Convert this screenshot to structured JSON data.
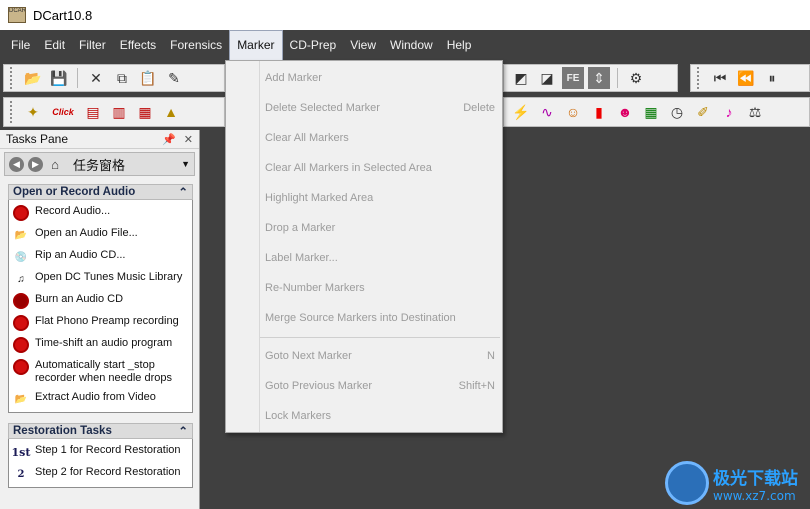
{
  "window": {
    "title": "DCart10.8",
    "icon": "dcart-app-icon"
  },
  "menubar": {
    "items": [
      "File",
      "Edit",
      "Filter",
      "Effects",
      "Forensics",
      "Marker",
      "CD-Prep",
      "View",
      "Window",
      "Help"
    ],
    "active": "Marker"
  },
  "marker_menu": {
    "items": [
      {
        "label": "Add Marker",
        "shortcut": "",
        "enabled": false
      },
      {
        "label": "Delete Selected Marker",
        "shortcut": "Delete",
        "enabled": false
      },
      {
        "label": "Clear All Markers",
        "shortcut": "",
        "enabled": false
      },
      {
        "label": "Clear All Markers in Selected Area",
        "shortcut": "",
        "enabled": false
      },
      {
        "label": "Highlight Marked Area",
        "shortcut": "",
        "enabled": false
      },
      {
        "label": "Drop a Marker",
        "shortcut": "",
        "enabled": false
      },
      {
        "label": "Label Marker...",
        "shortcut": "",
        "enabled": false
      },
      {
        "label": "Re-Number Markers",
        "shortcut": "",
        "enabled": false
      },
      {
        "label": "Merge Source Markers into Destination",
        "shortcut": "",
        "enabled": false
      },
      {
        "label": "Goto Next Marker",
        "shortcut": "N",
        "enabled": false
      },
      {
        "label": "Goto Previous Marker",
        "shortcut": "Shift+N",
        "enabled": false
      },
      {
        "label": "Lock Markers",
        "shortcut": "",
        "enabled": false
      }
    ]
  },
  "tasks_pane": {
    "title": "Tasks Pane",
    "nav_title": "任务窗格",
    "sections": [
      {
        "title": "Open or Record Audio",
        "items": [
          {
            "label": "Record Audio...",
            "icon": "record-icon"
          },
          {
            "label": "Open an Audio File...",
            "icon": "folder-open-icon"
          },
          {
            "label": "Rip an Audio CD...",
            "icon": "rip-cd-icon"
          },
          {
            "label": "Open DC Tunes Music Library",
            "icon": "music-library-icon"
          },
          {
            "label": "Burn an Audio CD",
            "icon": "burn-cd-icon"
          },
          {
            "label": "Flat Phono Preamp recording",
            "icon": "record-icon"
          },
          {
            "label": "Time-shift an audio program",
            "icon": "record-icon"
          },
          {
            "label": "Automatically start _stop recorder when needle drops",
            "icon": "record-icon"
          },
          {
            "label": "Extract Audio from Video",
            "icon": "folder-open-icon"
          }
        ]
      },
      {
        "title": "Restoration Tasks",
        "items": [
          {
            "label": "Step 1 for Record Restoration",
            "icon": "step-1st-icon",
            "num": "1st"
          },
          {
            "label": "Step 2 for Record Restoration",
            "icon": "step-2-icon",
            "num": "2"
          }
        ]
      }
    ]
  },
  "toolbar_icons": {
    "row1": [
      "open-icon",
      "save-icon",
      "cut-icon",
      "copy-icon",
      "paste-icon",
      "wand-icon",
      "fe-icon",
      "split-icon",
      "gear-icon",
      "skip-start-icon",
      "rewind-icon",
      "pause-icon"
    ],
    "row2": [
      "effects-icon",
      "click-icon",
      "spectrum-icon",
      "graph-icon",
      "filter-icon",
      "marker-icon"
    ],
    "click_label": "Click"
  },
  "watermark": {
    "title": "极光下载站",
    "url": "www.xz7.com"
  },
  "colors": {
    "menubar_bg": "#404040",
    "menu_disabled": "#9c9c9c",
    "record_red": "#d40f0f"
  }
}
